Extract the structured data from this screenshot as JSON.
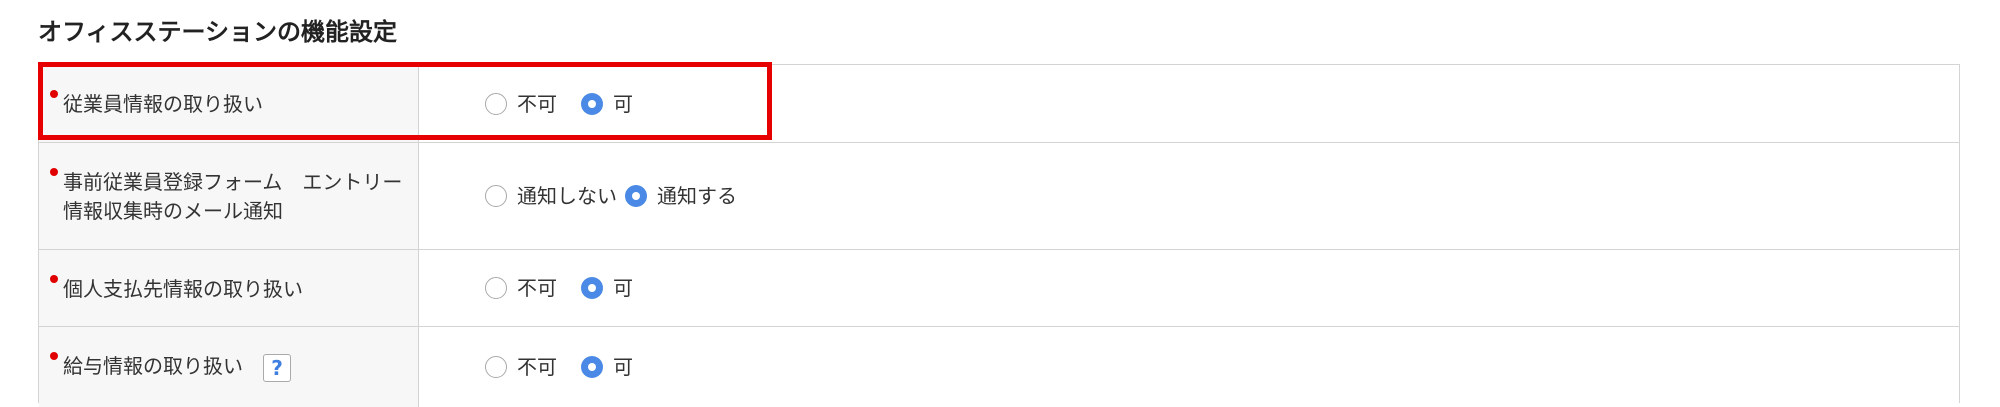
{
  "section": {
    "title": "オフィスステーションの機能設定"
  },
  "rows": [
    {
      "label": "従業員情報の取り扱い",
      "options": [
        {
          "label": "不可",
          "checked": false
        },
        {
          "label": "可",
          "checked": true
        }
      ]
    },
    {
      "label": "事前従業員登録フォーム　エントリー情報収集時のメール通知",
      "options": [
        {
          "label": "通知しない",
          "checked": false
        },
        {
          "label": "通知する",
          "checked": true
        }
      ]
    },
    {
      "label": "個人支払先情報の取り扱い",
      "options": [
        {
          "label": "不可",
          "checked": false
        },
        {
          "label": "可",
          "checked": true
        }
      ]
    },
    {
      "label": "給与情報の取り扱い",
      "help_icon": "?",
      "options": [
        {
          "label": "不可",
          "checked": false
        },
        {
          "label": "可",
          "checked": true
        }
      ]
    }
  ],
  "colors": {
    "required_marker": "#e00000",
    "radio_checked": "#4a8ae6",
    "highlight": "#e60000",
    "help_icon": "#3f7fe0"
  }
}
